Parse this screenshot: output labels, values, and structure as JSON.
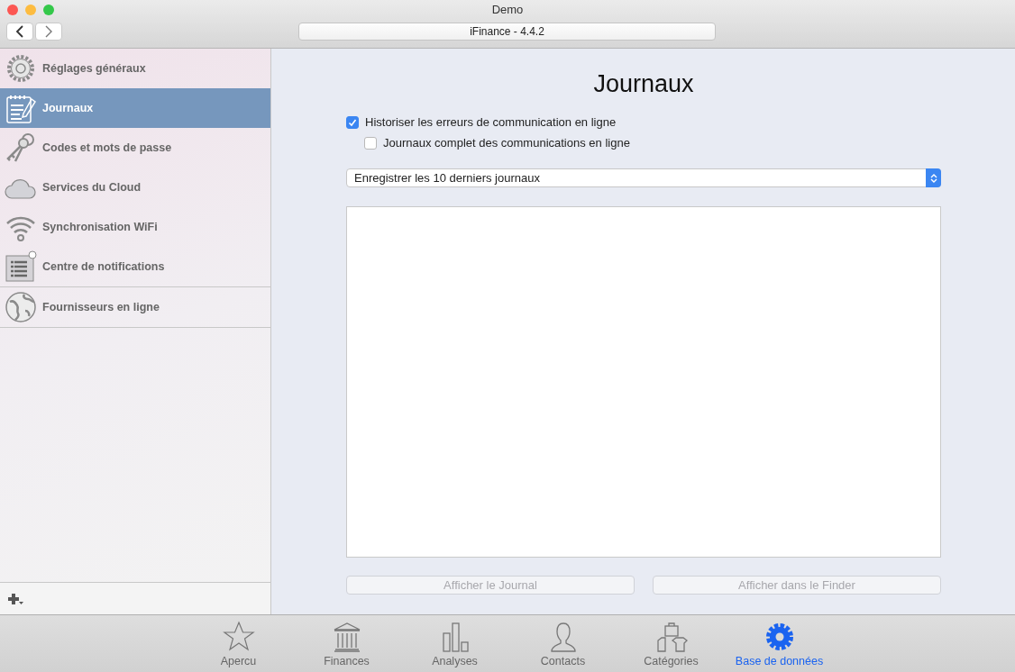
{
  "window": {
    "title": "Demo"
  },
  "toolbar": {
    "path_field": "iFinance - 4.4.2"
  },
  "sidebar": {
    "groups": [
      {
        "items": [
          {
            "label": "Réglages généraux",
            "selected": false
          },
          {
            "label": "Journaux",
            "selected": true
          },
          {
            "label": "Codes et mots de passe",
            "selected": false
          },
          {
            "label": "Services du Cloud",
            "selected": false
          },
          {
            "label": "Synchronisation WiFi",
            "selected": false
          },
          {
            "label": "Centre de notifications",
            "selected": false
          }
        ]
      },
      {
        "items": [
          {
            "label": "Fournisseurs en ligne",
            "selected": false
          }
        ]
      }
    ]
  },
  "content": {
    "title": "Journaux",
    "options": [
      {
        "label": "Historiser les erreurs de communication en ligne",
        "checked": true
      },
      {
        "label": "Journaux complet des communications en ligne",
        "checked": false
      }
    ],
    "select": {
      "value": "Enregistrer les 10 derniers journaux"
    },
    "buttons": [
      {
        "label": "Afficher le Journal",
        "disabled": true
      },
      {
        "label": "Afficher dans le Finder",
        "disabled": true
      }
    ]
  },
  "tabs": [
    {
      "label": "Apercu",
      "selected": false
    },
    {
      "label": "Finances",
      "selected": false
    },
    {
      "label": "Analyses",
      "selected": false
    },
    {
      "label": "Contacts",
      "selected": false
    },
    {
      "label": "Catégories",
      "selected": false
    },
    {
      "label": "Base de données",
      "selected": true
    }
  ]
}
